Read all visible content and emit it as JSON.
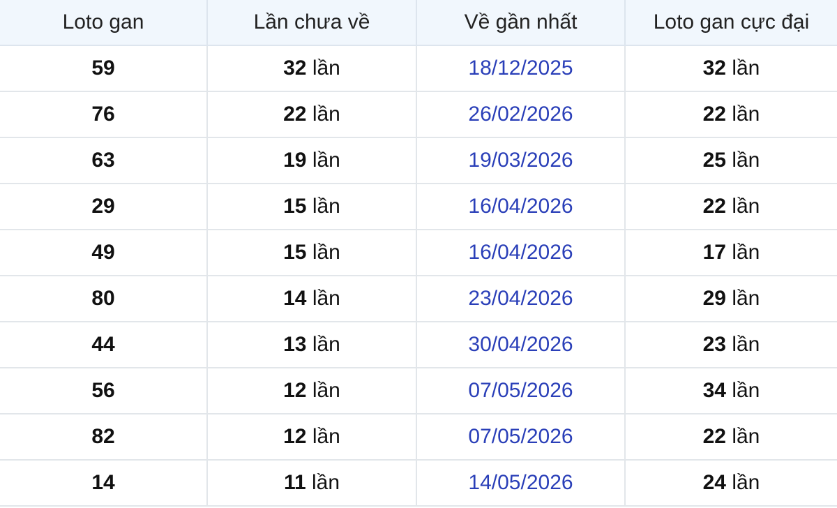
{
  "table": {
    "headers": [
      "Loto gan",
      "Lần chưa về",
      "Về gần nhất",
      "Loto gan cực đại"
    ],
    "unit": "lần",
    "rows": [
      {
        "loto": "59",
        "missed": "32",
        "last": "18/12/2025",
        "max": "32"
      },
      {
        "loto": "76",
        "missed": "22",
        "last": "26/02/2026",
        "max": "22"
      },
      {
        "loto": "63",
        "missed": "19",
        "last": "19/03/2026",
        "max": "25"
      },
      {
        "loto": "29",
        "missed": "15",
        "last": "16/04/2026",
        "max": "22"
      },
      {
        "loto": "49",
        "missed": "15",
        "last": "16/04/2026",
        "max": "17"
      },
      {
        "loto": "80",
        "missed": "14",
        "last": "23/04/2026",
        "max": "29"
      },
      {
        "loto": "44",
        "missed": "13",
        "last": "30/04/2026",
        "max": "23"
      },
      {
        "loto": "56",
        "missed": "12",
        "last": "07/05/2026",
        "max": "34"
      },
      {
        "loto": "82",
        "missed": "12",
        "last": "07/05/2026",
        "max": "22"
      },
      {
        "loto": "14",
        "missed": "11",
        "last": "14/05/2026",
        "max": "24"
      }
    ]
  },
  "colors": {
    "header_bg": "#f1f7fd",
    "date_text": "#2a3fb8",
    "grid": "#e2e6ea"
  }
}
